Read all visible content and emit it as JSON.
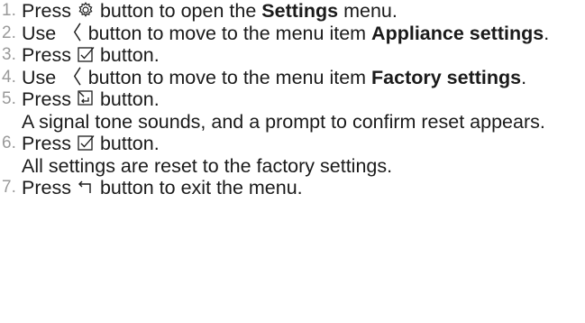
{
  "steps": [
    {
      "num": "1.",
      "t1": "Press",
      "icon": "settings-gear-icon",
      "t2": "button to open the",
      "b": "Settings",
      "t3": "menu."
    },
    {
      "num": "2.",
      "t1": "Use",
      "icon": "left-arrow-icon",
      "t2": "button to move to the menu item",
      "b": "Appliance settings",
      "t3": "."
    },
    {
      "num": "3.",
      "t1": "Press",
      "icon": "confirm-check-icon",
      "t2": "button."
    },
    {
      "num": "4.",
      "t1": "Use",
      "icon": "left-arrow-icon",
      "t2": "button to move to the menu item",
      "b": "Factory settings",
      "t3": "."
    },
    {
      "num": "5.",
      "t1": "Press",
      "icon": "enter-icon",
      "t2": "button.",
      "note": "A signal tone sounds, and a prompt to confirm reset appears."
    },
    {
      "num": "6.",
      "t1": "Press",
      "icon": "confirm-check-icon",
      "t2": "button.",
      "note": "All settings are reset to the factory settings."
    },
    {
      "num": "7.",
      "t1": "Press",
      "icon": "back-arrow-icon",
      "t2": "button to exit the menu."
    }
  ],
  "glyphs": {
    "left_arrow": "〈"
  }
}
